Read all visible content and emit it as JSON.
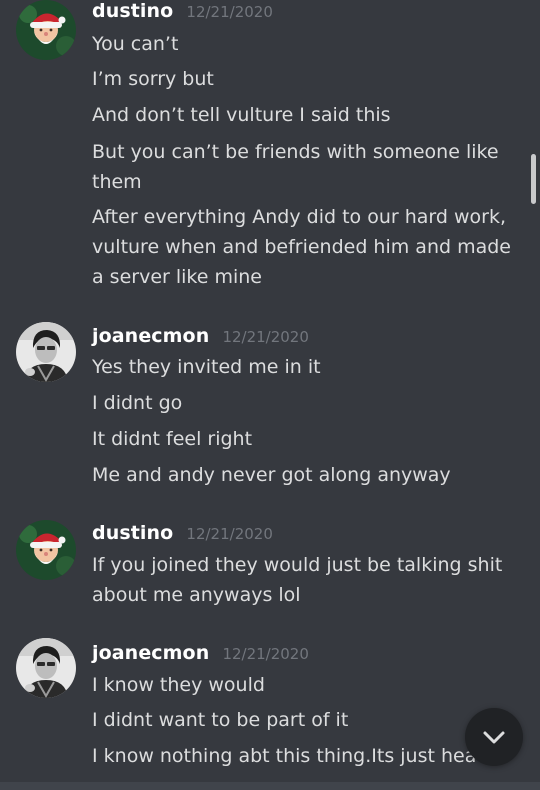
{
  "messages": [
    {
      "username": "dustino",
      "timestamp": "12/21/2020",
      "avatar_icon": "santa-avatar-icon",
      "lines": [
        "You can’t",
        "I’m sorry but",
        "And don’t tell vulture I said this",
        "But you can’t be friends with someone like them",
        "After everything Andy did to our hard work, vulture when and befriended him and made a server like mine"
      ]
    },
    {
      "username": "joanecmon",
      "timestamp": "12/21/2020",
      "avatar_icon": "person-photo-avatar-icon",
      "lines": [
        "Yes they invited me in it",
        "I didnt go",
        "It didnt feel right",
        "Me and andy never got along anyway"
      ]
    },
    {
      "username": "dustino",
      "timestamp": "12/21/2020",
      "avatar_icon": "santa-avatar-icon",
      "lines": [
        "If you joined they would just be talking shit about me anyways lol"
      ]
    },
    {
      "username": "joanecmon",
      "timestamp": "12/21/2020",
      "avatar_icon": "person-photo-avatar-icon",
      "lines": [
        "I know they would",
        "I didnt want to be part of it",
        "I know nothing abt this thing.Its just hea"
      ]
    }
  ],
  "colors": {
    "background": "#36393f",
    "username": "#ffffff",
    "message_text": "#dcddde",
    "timestamp": "#72767d",
    "jump_button": "#202225"
  },
  "jump_button_icon": "chevron-down-icon"
}
